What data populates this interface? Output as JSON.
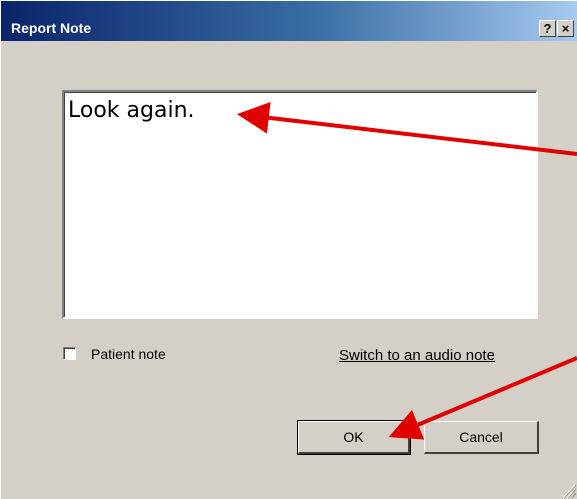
{
  "window": {
    "title": "Report Note",
    "help_label": "?",
    "close_label": "×"
  },
  "note": {
    "text": "Look again."
  },
  "options": {
    "patient_note_label": "Patient note",
    "patient_note_checked": false,
    "audio_link_label": "Switch to an audio note"
  },
  "buttons": {
    "ok_label": "OK",
    "cancel_label": "Cancel"
  },
  "colors": {
    "annotation_arrow": "#e00000",
    "dialog_face": "#d4d0c8",
    "titlebar_start": "#0a246a"
  }
}
